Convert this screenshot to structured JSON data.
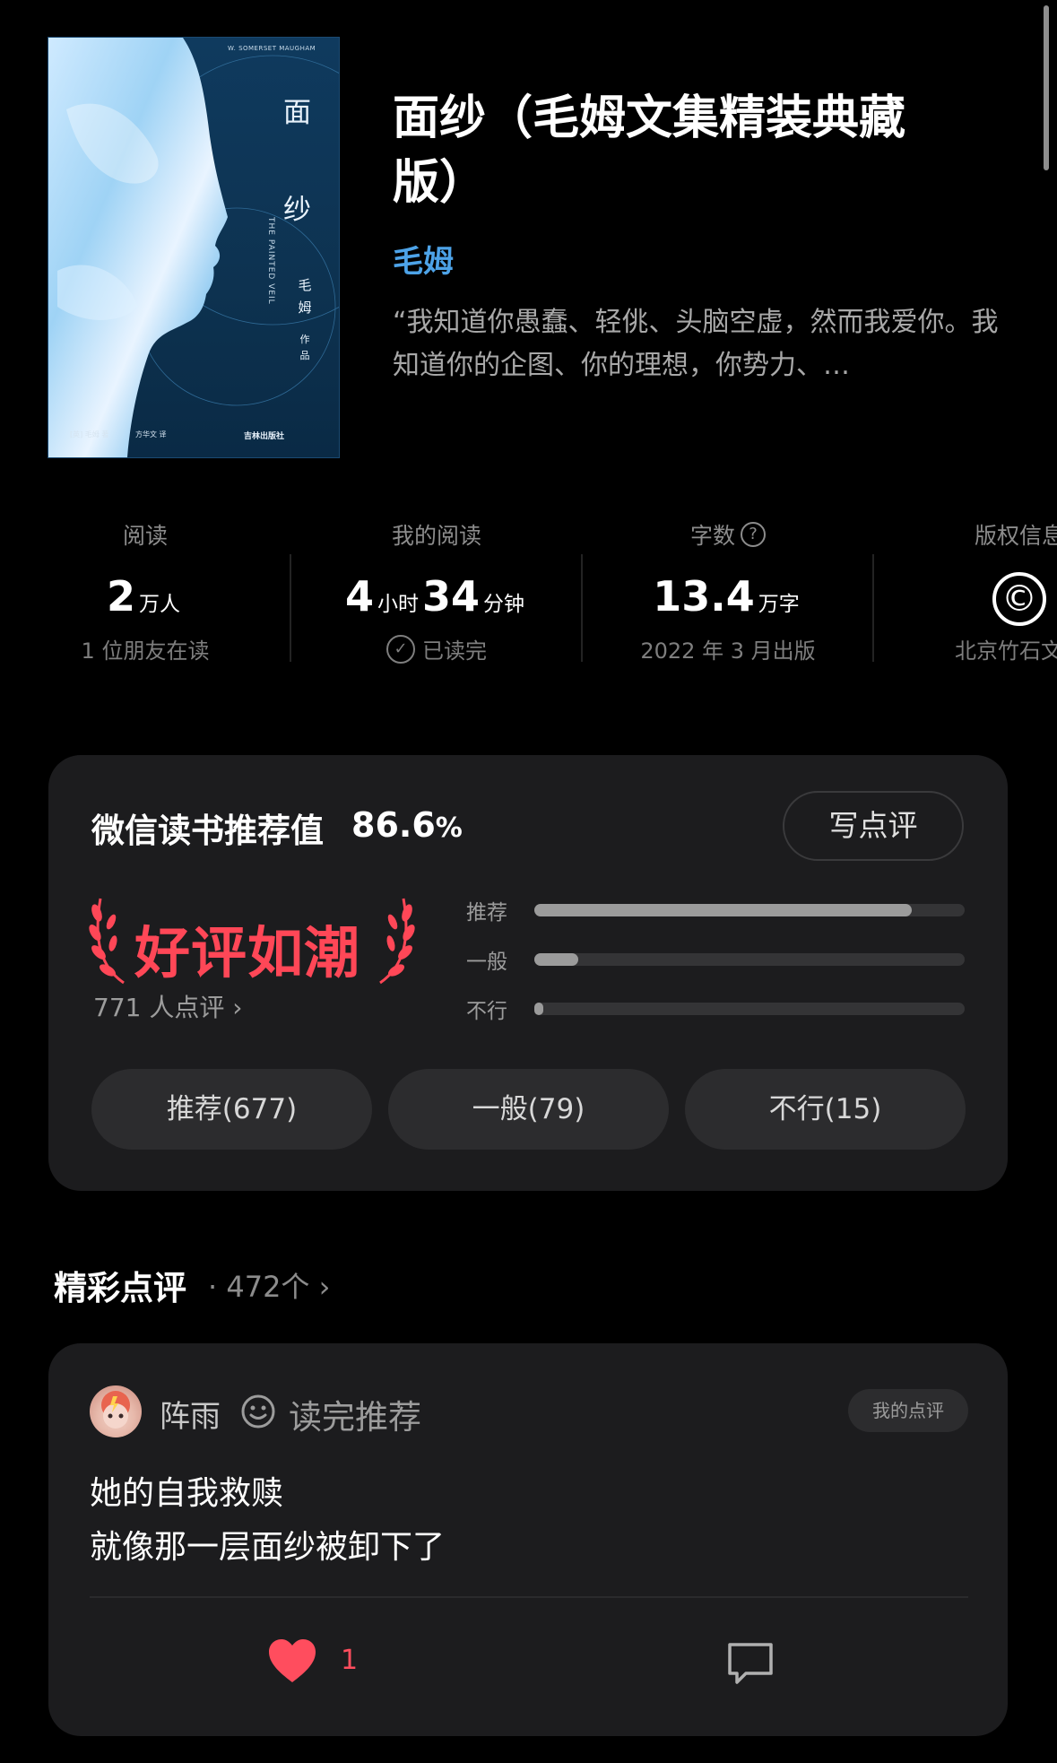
{
  "book": {
    "title": "面纱（毛姆文集精装典藏版）",
    "author": "毛姆",
    "intro": "“我知道你愚蠢、轻佻、头脑空虚，然而我爱你。我知道你的企图、你的理想，你势力、…",
    "cover": {
      "title_text": "面 纱",
      "author_text": "毛 姆",
      "work_text": "作 品",
      "top_line": "W. SOMERSET MAUGHAM",
      "vertical_text": "THE PAINTED VEIL",
      "bottom_left": "[英] 毛姆  著",
      "bottom_mid": "方华文  译",
      "publisher": "吉林出版社"
    }
  },
  "stats": [
    {
      "label": "阅读",
      "value": "2",
      "unit": "万人",
      "sub": "1 位朋友在读"
    },
    {
      "label": "我的阅读",
      "value_a": "4",
      "unit_a": "小时",
      "value_b": "34",
      "unit_b": "分钟",
      "sub": "已读完"
    },
    {
      "label": "字数",
      "value": "13.4",
      "unit": "万字",
      "sub": "2022 年 3 月出版"
    },
    {
      "label": "版权信息",
      "icon": "copyright-icon",
      "icon_glyph": "©",
      "sub": "北京竹石文化"
    }
  ],
  "rating": {
    "title": "微信读书推荐值",
    "value": "86.6",
    "percent_sign": "%",
    "write_label": "写点评",
    "badge": "好评如潮",
    "review_count": "771 人点评",
    "review_chevron": "›",
    "bars": [
      {
        "label": "推荐",
        "fraction": 0.878
      },
      {
        "label": "一般",
        "fraction": 0.102
      },
      {
        "label": "不行",
        "fraction": 0.019
      }
    ],
    "buttons": [
      "推荐(677)",
      "一般(79)",
      "不行(15)"
    ]
  },
  "featured": {
    "title": "精彩点评",
    "count": "· 472个 ›"
  },
  "review": {
    "user": "阵雨",
    "status": "读完推荐",
    "badge": "我的点评",
    "lines": [
      "她的自我救赎",
      "就像那一层面纱被卸下了"
    ],
    "likes": "1"
  },
  "colors": {
    "background": "#000000",
    "card": "#1c1c1e",
    "accent_blue": "#4da3e8",
    "badge_red": "#ff4757",
    "heart_red": "#ff4d5e"
  }
}
